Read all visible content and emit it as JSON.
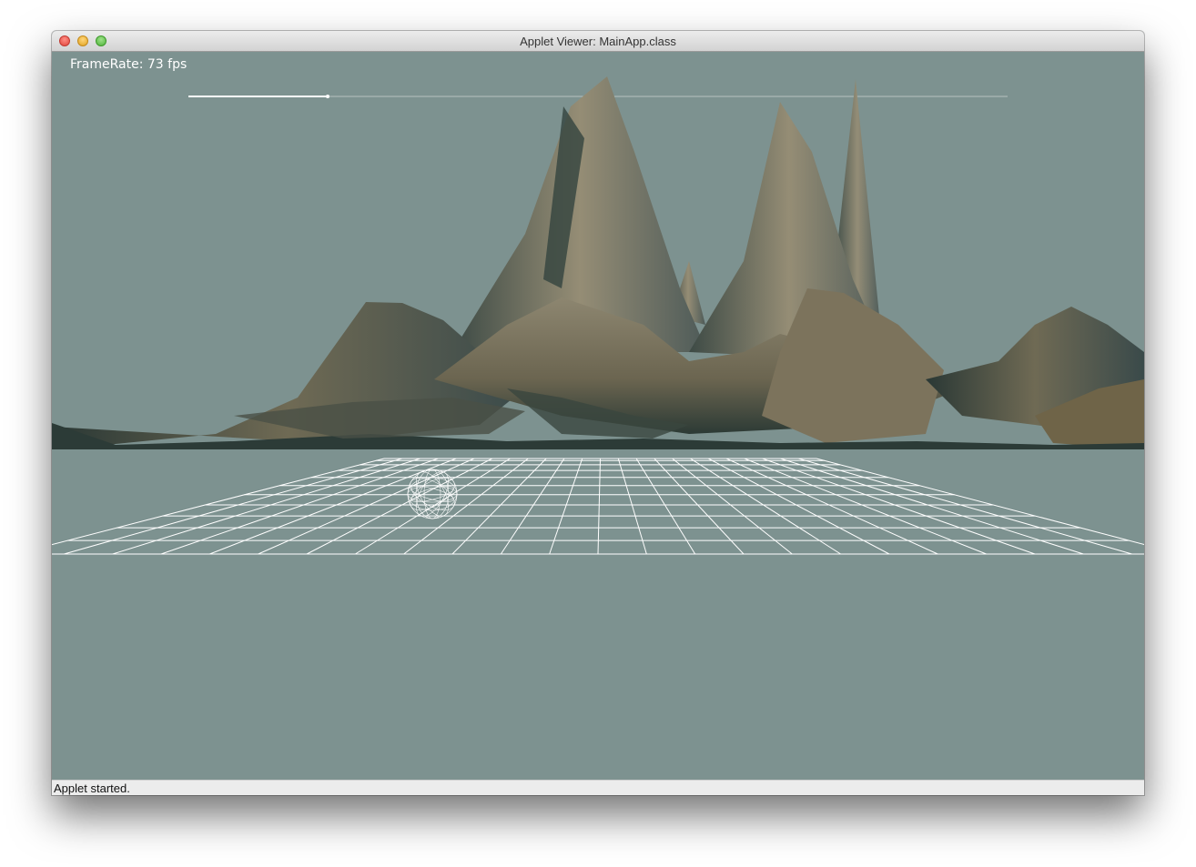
{
  "window": {
    "title": "Applet Viewer: MainApp.class",
    "traffic_lights": [
      "close",
      "minimize",
      "maximize"
    ]
  },
  "canvas": {
    "framerate_label": "FrameRate: 73 fps",
    "background_color": "#7d9290",
    "slider_value": 0.17
  },
  "status_bar": {
    "text": "Applet started."
  }
}
